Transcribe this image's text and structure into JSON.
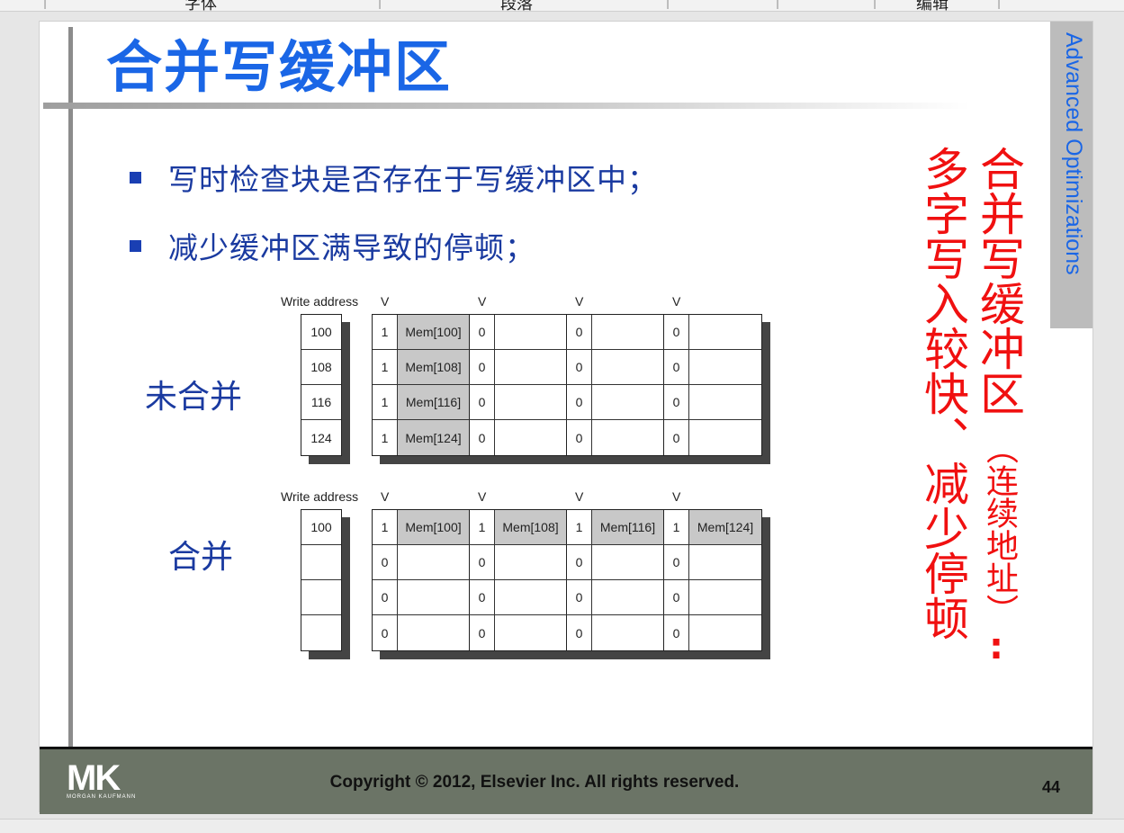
{
  "top_strip": {
    "fragments": [
      "字体",
      "段落",
      "编辑"
    ]
  },
  "slide": {
    "title": "合并写缓冲区",
    "side_tab": "Advanced Optimizations",
    "bullets": [
      "写时检查块是否存在于写缓冲区中；",
      "减少缓冲区满导致的停顿；"
    ],
    "diagram_unmerged": {
      "label": "未合并",
      "write_address_header": "Write address",
      "v_header": "V",
      "addresses": [
        "100",
        "108",
        "116",
        "124"
      ],
      "rows": [
        [
          {
            "v": "1",
            "d": "Mem[100]"
          },
          {
            "v": "0",
            "d": ""
          },
          {
            "v": "0",
            "d": ""
          },
          {
            "v": "0",
            "d": ""
          }
        ],
        [
          {
            "v": "1",
            "d": "Mem[108]"
          },
          {
            "v": "0",
            "d": ""
          },
          {
            "v": "0",
            "d": ""
          },
          {
            "v": "0",
            "d": ""
          }
        ],
        [
          {
            "v": "1",
            "d": "Mem[116]"
          },
          {
            "v": "0",
            "d": ""
          },
          {
            "v": "0",
            "d": ""
          },
          {
            "v": "0",
            "d": ""
          }
        ],
        [
          {
            "v": "1",
            "d": "Mem[124]"
          },
          {
            "v": "0",
            "d": ""
          },
          {
            "v": "0",
            "d": ""
          },
          {
            "v": "0",
            "d": ""
          }
        ]
      ]
    },
    "diagram_merged": {
      "label": "合并",
      "write_address_header": "Write address",
      "v_header": "V",
      "addresses": [
        "100",
        "",
        "",
        ""
      ],
      "rows": [
        [
          {
            "v": "1",
            "d": "Mem[100]"
          },
          {
            "v": "1",
            "d": "Mem[108]"
          },
          {
            "v": "1",
            "d": "Mem[116]"
          },
          {
            "v": "1",
            "d": "Mem[124]"
          }
        ],
        [
          {
            "v": "0",
            "d": ""
          },
          {
            "v": "0",
            "d": ""
          },
          {
            "v": "0",
            "d": ""
          },
          {
            "v": "0",
            "d": ""
          }
        ],
        [
          {
            "v": "0",
            "d": ""
          },
          {
            "v": "0",
            "d": ""
          },
          {
            "v": "0",
            "d": ""
          },
          {
            "v": "0",
            "d": ""
          }
        ],
        [
          {
            "v": "0",
            "d": ""
          },
          {
            "v": "0",
            "d": ""
          },
          {
            "v": "0",
            "d": ""
          },
          {
            "v": "0",
            "d": ""
          }
        ]
      ]
    },
    "red_note": {
      "line1": "合并写缓冲区",
      "line1_small": "（连续地址）",
      "colon": ":",
      "line2": "多字写入较快、减少停顿"
    },
    "footer": {
      "logo_text": "MK",
      "logo_sub": "MORGAN KAUFMANN",
      "copyright": "Copyright © 2012, Elsevier Inc. All rights reserved.",
      "page_number": "44"
    }
  },
  "colors": {
    "title_blue": "#1a66e6",
    "red_note": "#f01010",
    "footer_bg": "#6b7466",
    "cell_fill": "#c8c8c8"
  }
}
